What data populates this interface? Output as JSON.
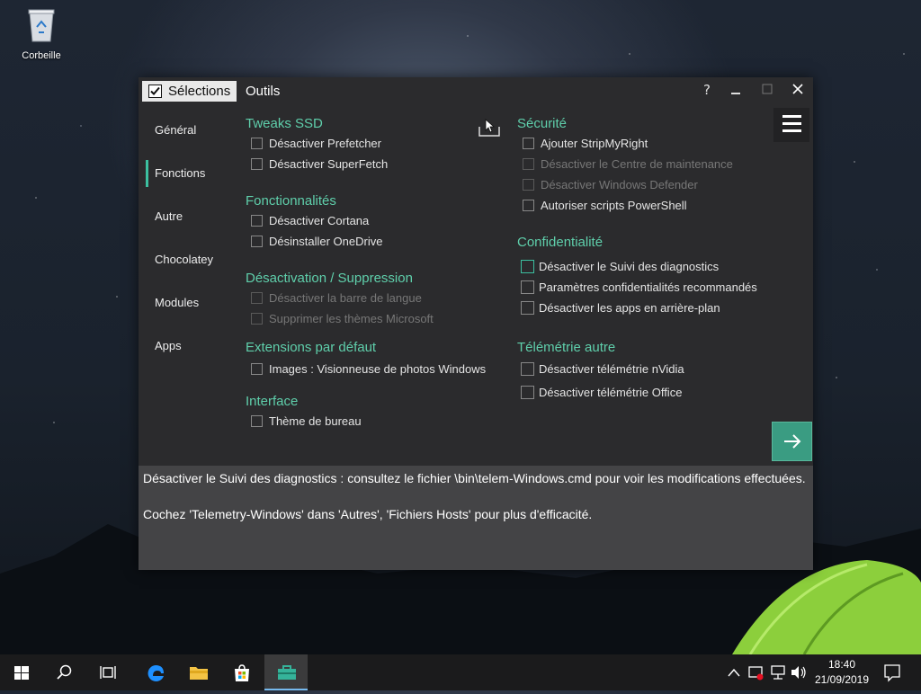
{
  "desktop": {
    "recycle_bin_label": "Corbeille"
  },
  "window": {
    "tabs": {
      "selections": "Sélections",
      "tools": "Outils"
    },
    "controls": {
      "help": "?"
    }
  },
  "sidebar": {
    "items": [
      {
        "label": "Général"
      },
      {
        "label": "Fonctions"
      },
      {
        "label": "Autre"
      },
      {
        "label": "Chocolatey"
      },
      {
        "label": "Modules"
      },
      {
        "label": "Apps"
      }
    ],
    "active_index": 1
  },
  "content": {
    "tweaks_ssd": {
      "title": "Tweaks SSD",
      "options": [
        "Désactiver Prefetcher",
        "Désactiver SuperFetch"
      ]
    },
    "fonctionnalites": {
      "title": "Fonctionnalités",
      "options": [
        "Désactiver Cortana",
        "Désinstaller OneDrive"
      ]
    },
    "desactivation": {
      "title": "Désactivation / Suppression",
      "options": [
        "Désactiver la barre de langue",
        "Supprimer les thèmes Microsoft"
      ]
    },
    "extensions": {
      "title": "Extensions par défaut",
      "options": [
        "Images : Visionneuse de photos Windows"
      ]
    },
    "interface": {
      "title": "Interface",
      "options": [
        "Thème de bureau"
      ]
    },
    "securite": {
      "title": "Sécurité",
      "options": [
        "Ajouter StripMyRight",
        "Désactiver le Centre de maintenance",
        "Désactiver Windows Defender",
        "Autoriser scripts PowerShell"
      ]
    },
    "confidentialite": {
      "title": "Confidentialité",
      "options": [
        "Désactiver le Suivi des diagnostics",
        "Paramètres confidentialités recommandés",
        "Désactiver les apps en arrière-plan"
      ]
    },
    "telemetrie": {
      "title": "Télémétrie autre",
      "options": [
        "Désactiver télémétrie nVidia",
        "Désactiver télémétrie Office"
      ]
    }
  },
  "info": {
    "line1": "Désactiver le Suivi des diagnostics : consultez le fichier \\bin\\telem-Windows.cmd pour voir les modifications effectuées.",
    "line2": "Cochez 'Telemetry-Windows' dans 'Autres', 'Fichiers Hosts' pour plus d'efficacité."
  },
  "taskbar": {
    "time": "18:40",
    "date": "21/09/2019",
    "accent_color": "#76b9ed"
  },
  "colors": {
    "section_title": "#5fcfab",
    "accent": "#3cc0a0",
    "next_button": "#3a9c82"
  }
}
